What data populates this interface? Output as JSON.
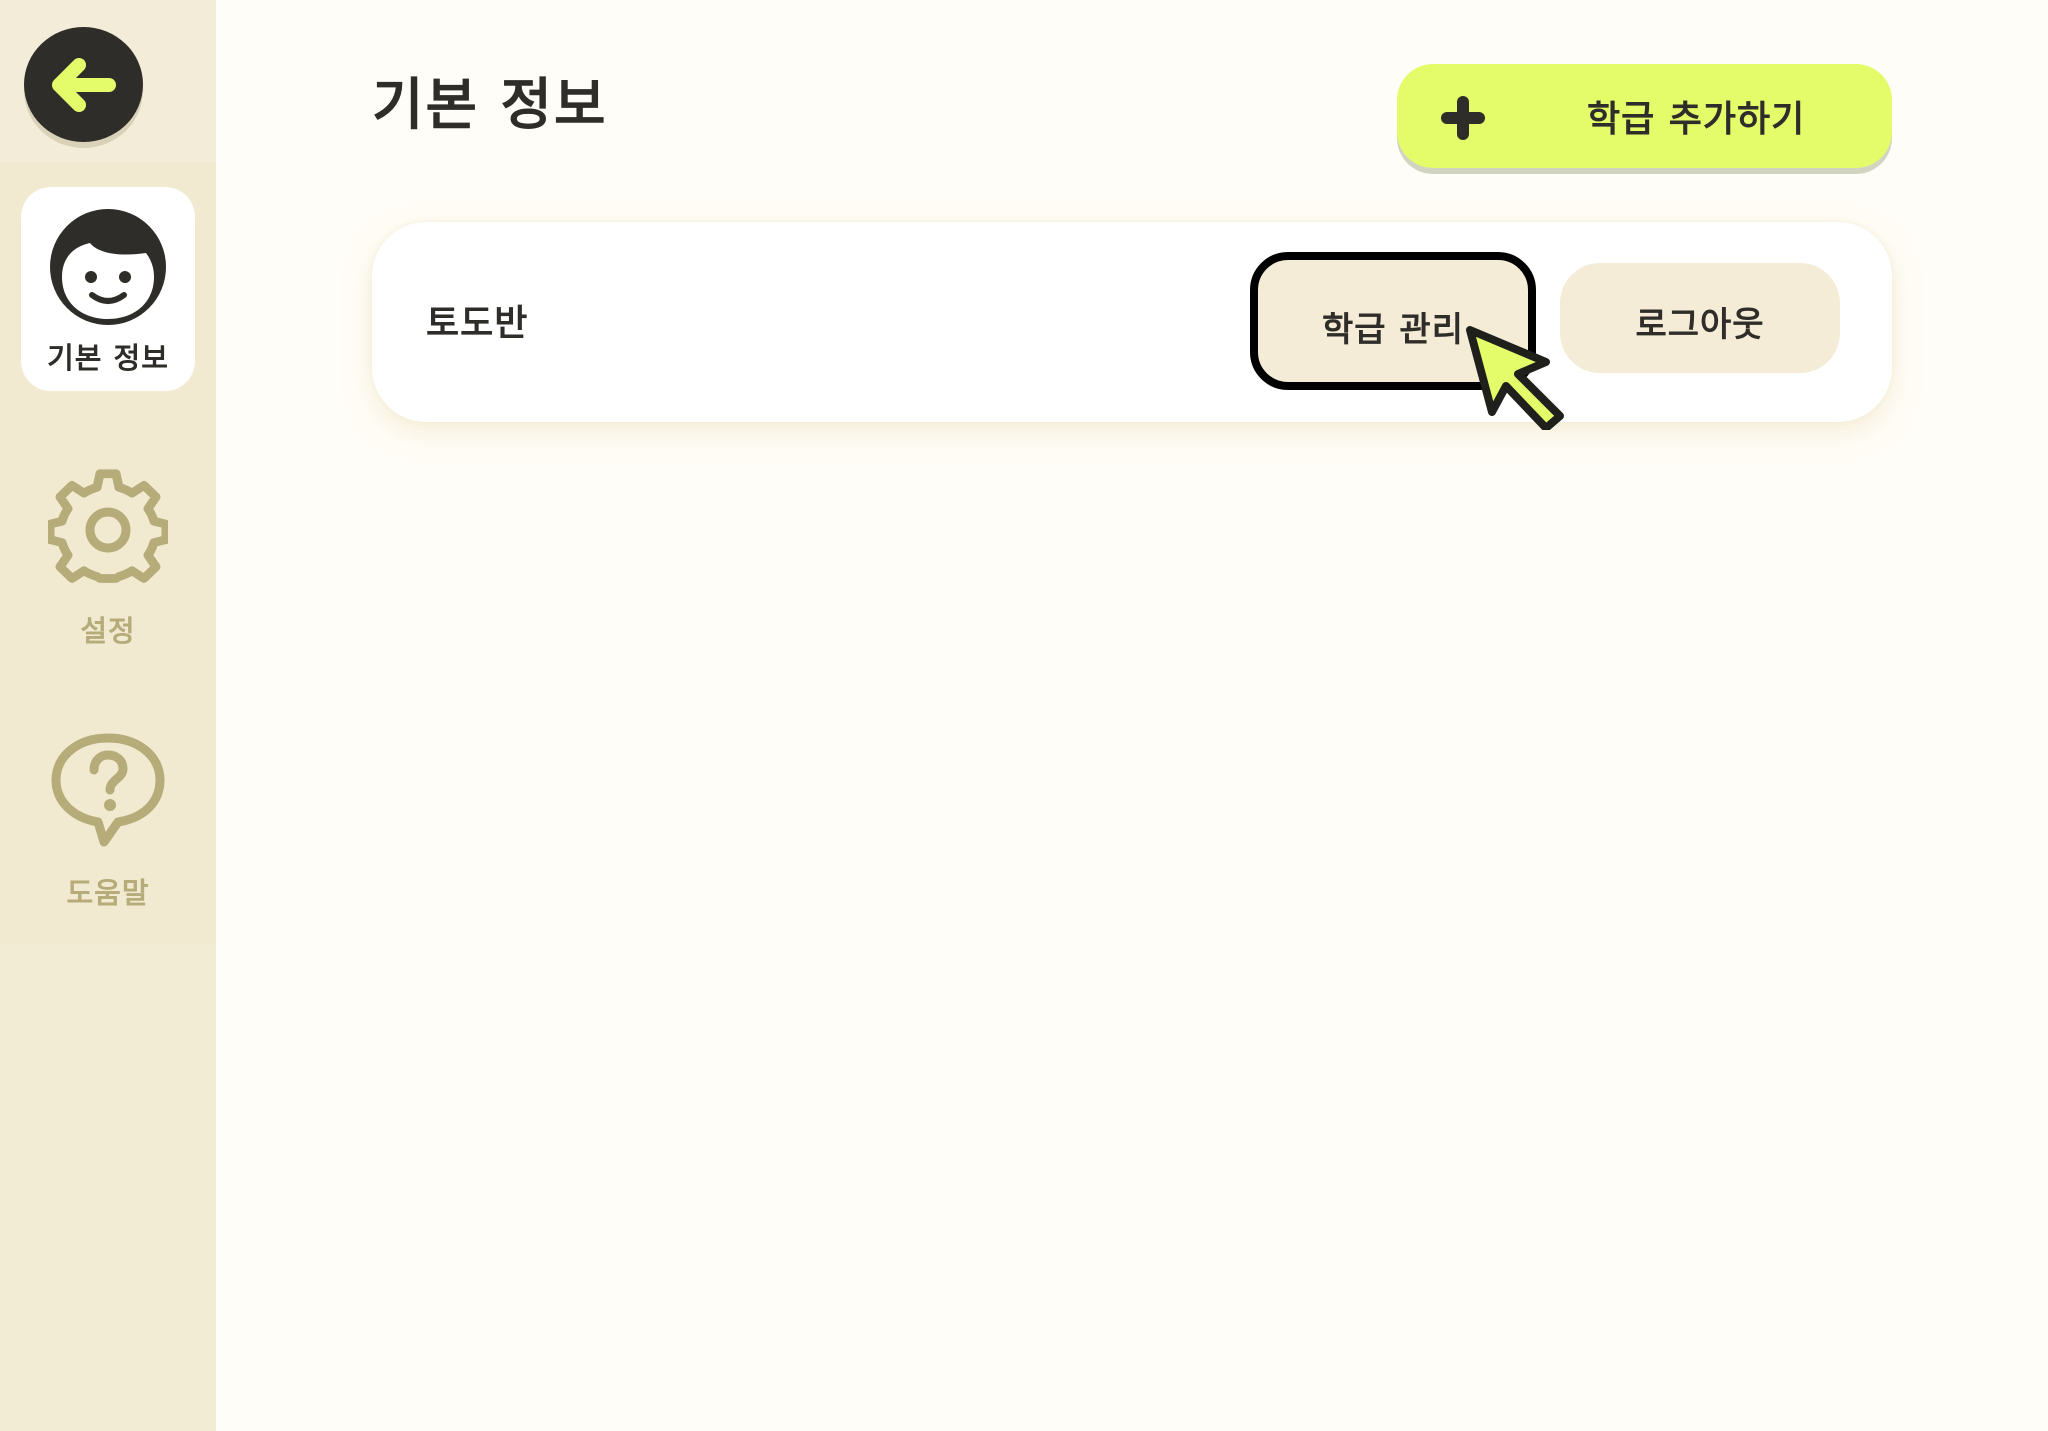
{
  "sidebar": {
    "back_icon": "arrow-left-icon",
    "items": [
      {
        "label": "기본 정보",
        "icon": "face-icon",
        "active": true
      },
      {
        "label": "설정",
        "icon": "gear-icon",
        "active": false
      },
      {
        "label": "도움말",
        "icon": "help-bubble-icon",
        "active": false
      }
    ]
  },
  "header": {
    "title": "기본 정보",
    "add_button_label": "학급 추가하기",
    "add_icon": "plus-icon"
  },
  "class_card": {
    "name": "토도반",
    "manage_label": "학급 관리",
    "logout_label": "로그아웃"
  },
  "colors": {
    "accent": "#e4fb6a",
    "sidebar_bg": "#f3ecd4",
    "page_bg": "#fffdf7",
    "button_bg": "#f4ecd6",
    "dark": "#2f2d29",
    "muted": "#b5ac7a"
  }
}
